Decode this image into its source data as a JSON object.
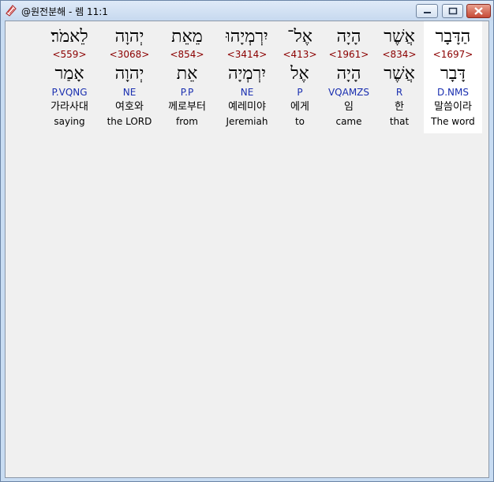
{
  "window": {
    "title": "@원전분해 - 렘 11:1"
  },
  "columns": [
    {
      "heb": "הַדָּבָר",
      "strong": "<1697>",
      "lemma": "דָּבָר",
      "morph": "D.NMS",
      "korean": "말씀이라",
      "english": "The word"
    },
    {
      "heb": "אֲשֶׁר",
      "strong": "<834>",
      "lemma": "אֲשֶׁר",
      "morph": "R",
      "korean": "한",
      "english": "that"
    },
    {
      "heb": "הָיָה",
      "strong": "<1961>",
      "lemma": "הָיָה",
      "morph": "VQAMZS",
      "korean": "임",
      "english": "came"
    },
    {
      "heb": "אֶל־",
      "strong": "<413>",
      "lemma": "אֶל",
      "morph": "P",
      "korean": "에게",
      "english": "to"
    },
    {
      "heb": "יִרְמְיָהוּ",
      "strong": "<3414>",
      "lemma": "יִרְמְיָה",
      "morph": "NE",
      "korean": "예레미야",
      "english": "Jeremiah"
    },
    {
      "heb": "מֵאֵת",
      "strong": "<854>",
      "lemma": "אֵת",
      "morph": "P.P",
      "korean": "께로부터",
      "english": "from"
    },
    {
      "heb": "יְהוָה",
      "strong": "<3068>",
      "lemma": "יְהוָה",
      "morph": "NE",
      "korean": "여호와",
      "english": "the LORD"
    },
    {
      "heb": "לֵאמֹר׃",
      "strong": "<559>",
      "lemma": "אָמַר",
      "morph": "P.VQNG",
      "korean": "가라사대",
      "english": "saying"
    }
  ]
}
